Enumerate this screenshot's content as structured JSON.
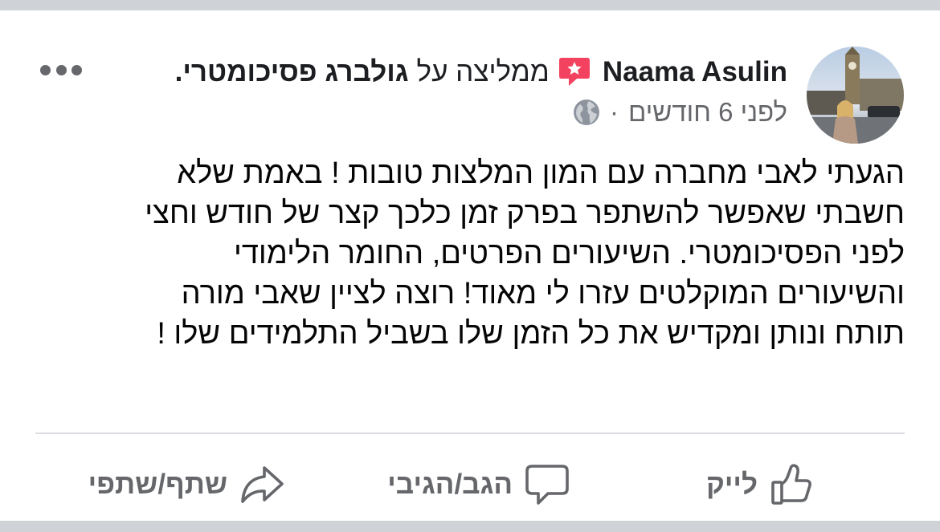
{
  "post": {
    "author": "Naama Asulin",
    "recommends_text": "ממליצה על",
    "page_name": "גולברג פסיכומטרי.",
    "timestamp": "לפני 6 חודשים",
    "separator": "·",
    "privacy_icon": "globe-icon",
    "more_icon": "more-options-icon",
    "text_lines": [
      "הגעתי לאבי מחברה עם המון המלצות טובות ! באמת שלא",
      "חשבתי שאפשר להשתפר בפרק זמן כלכך קצר של חודש וחצי",
      "לפני הפסיכומטרי. השיעורים הפרטים, החומר הלימודי",
      "והשיעורים המוקלטים עזרו לי מאוד! רוצה לציין שאבי מורה",
      "תותח ונותן ומקדיש את כל הזמן שלו בשביל התלמידים שלו !"
    ]
  },
  "actions": {
    "like": {
      "label": "לייק",
      "icon": "thumbs-up-icon"
    },
    "comment": {
      "label": "הגב/הגיבי",
      "icon": "comment-bubble-icon"
    },
    "share": {
      "label": "שתף/שתפי",
      "icon": "share-arrow-icon"
    }
  },
  "colors": {
    "background": "#cfd2d6",
    "card": "#ffffff",
    "text": "#050505",
    "muted": "#65676b",
    "recommend_badge": "#f3425f",
    "divider": "#dadde1"
  }
}
